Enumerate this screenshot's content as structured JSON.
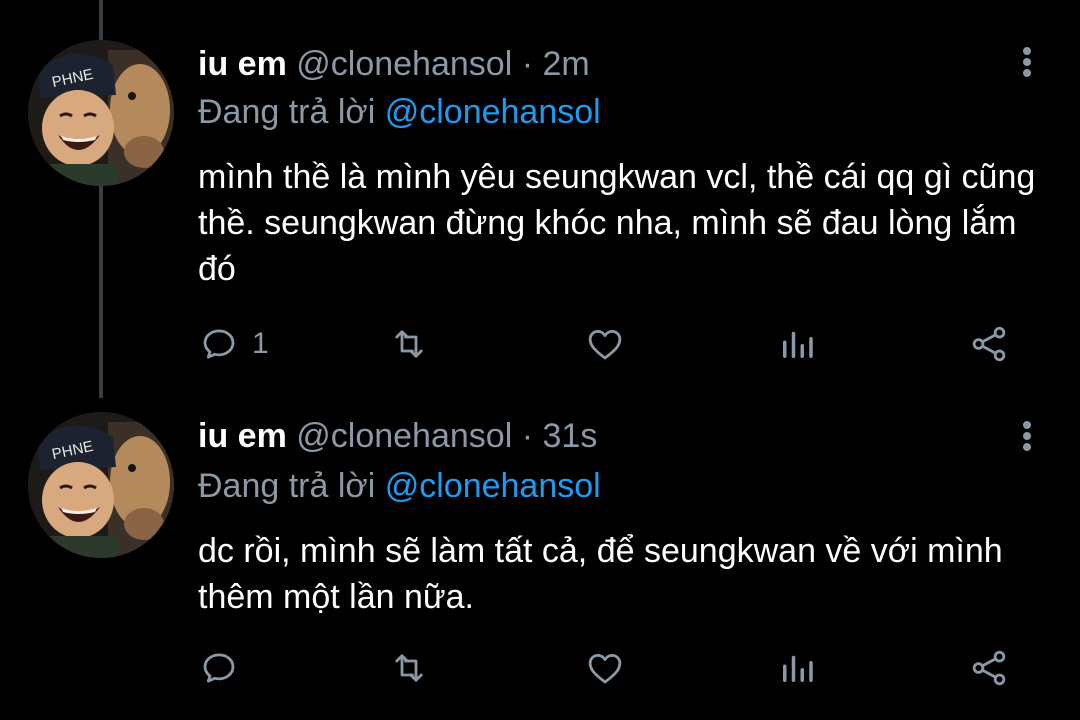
{
  "tweets": [
    {
      "name": "iu em",
      "handle": "@clonehansol",
      "separator": "·",
      "time": "2m",
      "reply_prefix": "Đang trả lời",
      "reply_to": "@clonehansol",
      "text": "mình thề là mình yêu seungkwan vcl, thề cái qq gì cũng thề. seungkwan đừng khóc nha, mình sẽ đau lòng lắm đó",
      "reply_count": "1"
    },
    {
      "name": "iu em",
      "handle": "@clonehansol",
      "separator": "·",
      "time": "31s",
      "reply_prefix": "Đang trả lời",
      "reply_to": "@clonehansol",
      "text": "dc rồi, mình sẽ làm tất cả, để seungkwan về với mình thêm một lần nữa.",
      "reply_count": ""
    }
  ],
  "icons": {
    "reply": "reply-icon",
    "retweet": "retweet-icon",
    "like": "heart-icon",
    "stats": "analytics-icon",
    "share": "share-icon",
    "more": "more-vertical-icon"
  },
  "colors": {
    "background": "#000000",
    "text": "#ffffff",
    "secondary": "#8b98a5",
    "accent": "#1d9bf0"
  }
}
